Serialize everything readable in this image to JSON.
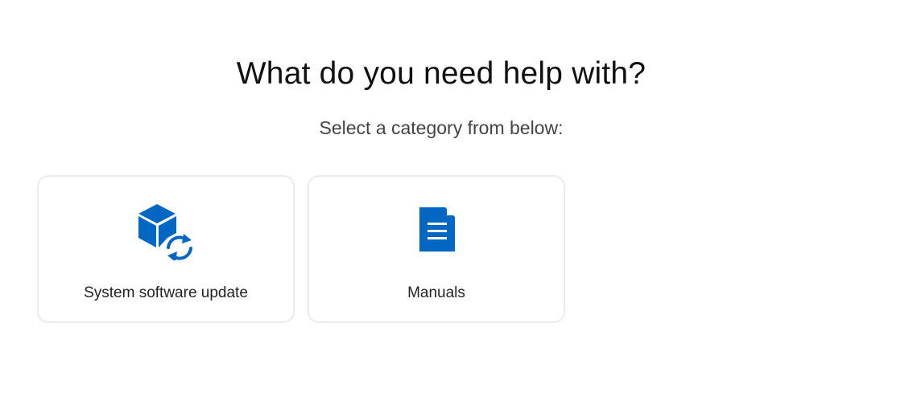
{
  "header": {
    "title": "What do you need help with?",
    "subtitle": "Select a category from below:"
  },
  "categories": [
    {
      "label": "System software update",
      "icon": "box-refresh-icon"
    },
    {
      "label": "Manuals",
      "icon": "document-icon"
    }
  ],
  "colors": {
    "accent": "#0068c3",
    "card_border": "#ebebeb",
    "title_text": "#111111",
    "subtitle_text": "#444444"
  }
}
